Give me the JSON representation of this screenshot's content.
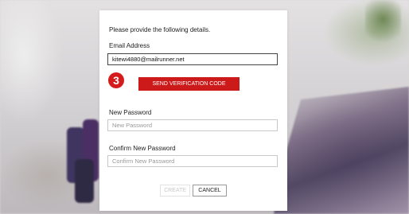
{
  "form": {
    "intro": "Please provide the following details.",
    "email_label": "Email Address",
    "email_value": "kitewi4880@mailrunner.net",
    "step_badge": "3",
    "send_code_label": "SEND VERIFICATION CODE",
    "new_password_label": "New Password",
    "new_password_placeholder": "New Password",
    "confirm_password_label": "Confirm New Password",
    "confirm_password_placeholder": "Confirm New Password",
    "create_label": "CREATE",
    "cancel_label": "CANCEL"
  },
  "colors": {
    "accent": "#cc1a1a",
    "badge": "#d51b1b"
  }
}
